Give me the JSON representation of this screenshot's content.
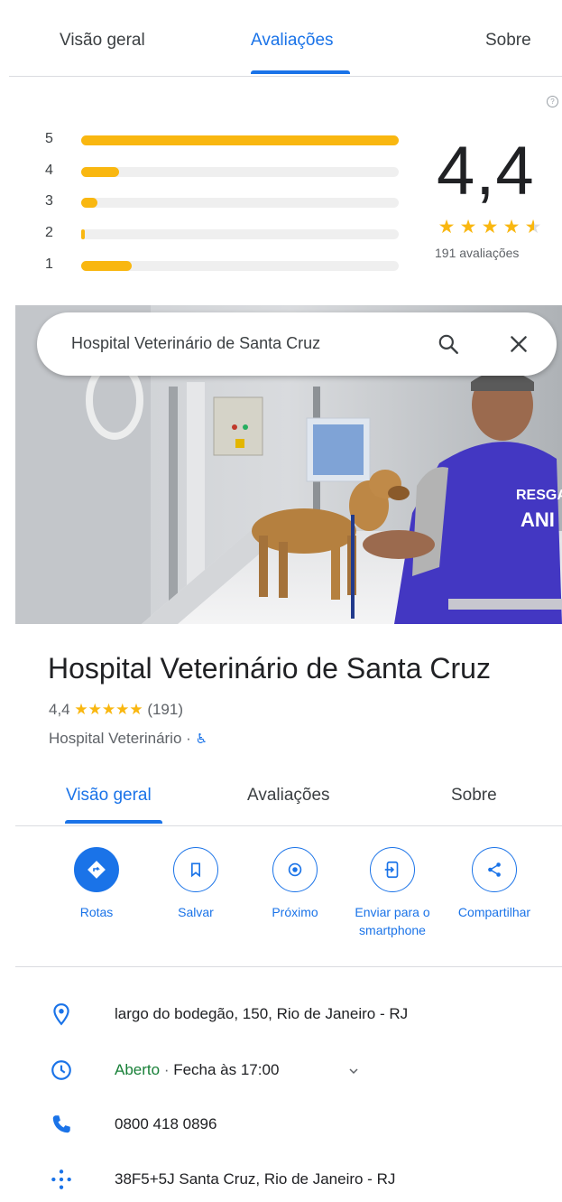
{
  "reviews_panel": {
    "tabs": [
      {
        "label": "Visão geral",
        "active": false
      },
      {
        "label": "Avaliações",
        "active": true
      },
      {
        "label": "Sobre",
        "active": false
      }
    ],
    "help_icon": "?",
    "histogram": [
      {
        "stars": "5",
        "fraction": 1.0
      },
      {
        "stars": "4",
        "fraction": 0.12
      },
      {
        "stars": "3",
        "fraction": 0.05
      },
      {
        "stars": "2",
        "fraction": 0.01
      },
      {
        "stars": "1",
        "fraction": 0.16
      }
    ],
    "average": "4,4",
    "review_count_text": "191 avaliações",
    "star_color": "#f9b710"
  },
  "search": {
    "query": "Hospital Veterinário de Santa Cruz",
    "search_icon": "search-icon",
    "close_icon": "close-icon"
  },
  "place": {
    "title": "Hospital Veterinário de Santa Cruz",
    "rating": "4,4",
    "stars": "★★★★★",
    "review_count": "(191)",
    "category": "Hospital Veterinário",
    "separator": "·",
    "accessibility_icon": "wheelchair-icon"
  },
  "tabs": [
    {
      "label": "Visão geral",
      "active": true
    },
    {
      "label": "Avaliações",
      "active": false
    },
    {
      "label": "Sobre",
      "active": false
    }
  ],
  "actions": [
    {
      "label": "Rotas",
      "icon": "directions-icon"
    },
    {
      "label": "Salvar",
      "icon": "bookmark-icon"
    },
    {
      "label": "Próximo",
      "icon": "nearby-icon"
    },
    {
      "label": "Enviar para o",
      "label2": "smartphone",
      "icon": "send-to-phone-icon"
    },
    {
      "label": "Compartilhar",
      "icon": "share-icon"
    }
  ],
  "details": {
    "address": "largo do bodegão, 150, Rio de Janeiro - RJ",
    "hours_status": "Aberto",
    "hours_sep": " · ",
    "hours_close": "Fecha às 17:00",
    "phone": "0800 418 0896",
    "plus_code": "38F5+5J Santa Cruz, Rio de Janeiro - RJ"
  },
  "colors": {
    "accent": "#1a73e8",
    "open_green": "#188038",
    "star_yellow": "#f9b710"
  }
}
